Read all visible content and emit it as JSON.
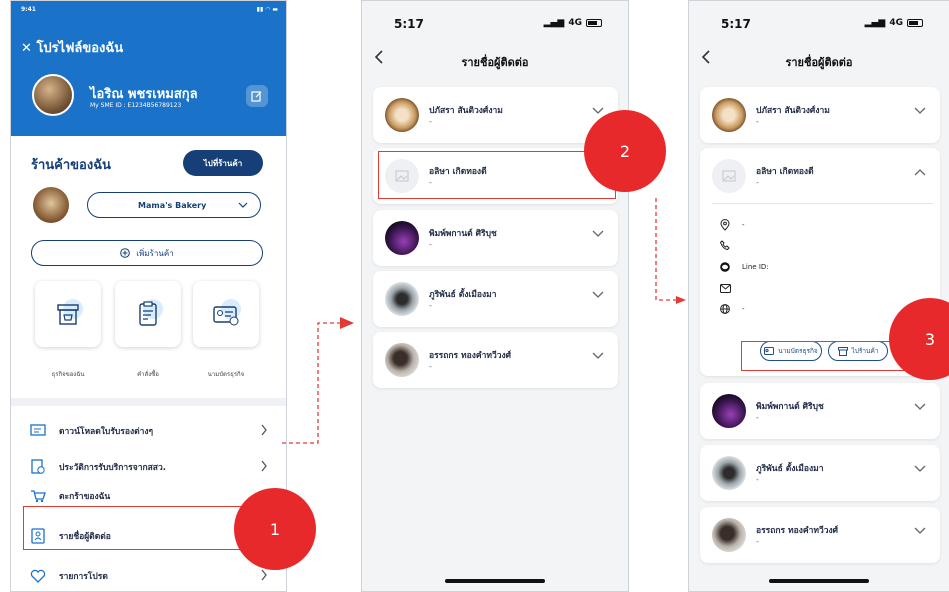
{
  "profile_screen": {
    "status_time": "9:41",
    "header_title": "โปรไฟล์ของฉัน",
    "user_name": "ไอริณ พชรเหมสกุล",
    "sme_id": "My SME ID : E1234B56789123",
    "shop_section_title": "ร้านค้าของฉัน",
    "go_shop_label": "ไปที่ร้านค้า",
    "shop_selected": "Mama's Bakery",
    "add_shop_label": "เพิ่มร้านค้า",
    "tiles": [
      {
        "label": "ธุรกิจของฉัน",
        "icon": "shop-icon"
      },
      {
        "label": "คำสั่งซื้อ",
        "icon": "clipboard-icon"
      },
      {
        "label": "นามบัตรธุรกิจ",
        "icon": "business-card-icon"
      }
    ],
    "menu_items": [
      {
        "label": "ดาวน์โหลดใบรับรองต่างๆ",
        "icon": "download-certificate-icon"
      },
      {
        "label": "ประวัติการรับบริการจากสสว.",
        "icon": "history-icon"
      },
      {
        "label": "ตะกร้าของฉัน",
        "icon": "cart-icon"
      },
      {
        "label": "รายชื่อผู้ติดต่อ",
        "icon": "contacts-icon"
      },
      {
        "label": "รายการโปรด",
        "icon": "heart-icon"
      }
    ]
  },
  "contacts_screen": {
    "status_time": "5:17",
    "network": "4G",
    "title": "รายชื่อผู้ติดต่อ",
    "contacts": [
      {
        "name": "ปภัสรา สันติวงศ์งาม",
        "desc": "-"
      },
      {
        "name": "อลิษา เกิดทองดี",
        "desc": "-"
      },
      {
        "name": "พิมพ์พกานต์ ศิริบุช",
        "desc": "-"
      },
      {
        "name": "ภูริพันธ์ ตั้งเมืองมา",
        "desc": "-"
      },
      {
        "name": "อรรถกร ทองคำทวีวงศ์",
        "desc": "-"
      }
    ]
  },
  "detail_screen": {
    "status_time": "5:17",
    "network": "4G",
    "title": "รายชื่อผู้ติดต่อ",
    "contacts": [
      {
        "name": "ปภัสรา สันติวงศ์งาม",
        "desc": "-"
      },
      {
        "name": "อลิษา เกิดทองดี",
        "desc": "-"
      },
      {
        "name": "พิมพ์พกานต์ ศิริบุช",
        "desc": "-"
      },
      {
        "name": "ภูริพันธ์ ตั้งเมืองมา",
        "desc": "-"
      },
      {
        "name": "อรรถกร ทองคำทวีวงศ์",
        "desc": "-"
      }
    ],
    "details": {
      "address": "-",
      "line_label": "Line ID:",
      "website": "-"
    },
    "business_button": "นามบัตรธุรกิจ",
    "shop_button": "ไปร้านค้า"
  },
  "annotations": {
    "step1": "1",
    "step2": "2",
    "step3": "3",
    "color": "#e8292b"
  },
  "colors": {
    "primary_blue": "#1b72c9",
    "navy": "#163f77",
    "highlight_red": "#e23b36"
  }
}
